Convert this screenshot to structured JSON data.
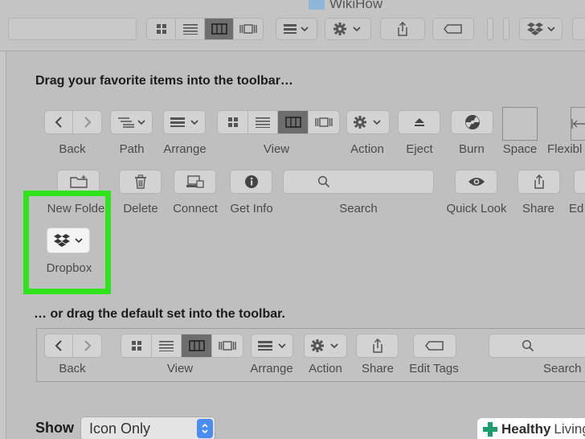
{
  "window": {
    "title": "WikiHow"
  },
  "sheet": {
    "heading_top": "Drag your favorite items into the toolbar…",
    "heading_default": "… or drag the default set into the toolbar.",
    "items_row1": {
      "back": "Back",
      "path": "Path",
      "arrange": "Arrange",
      "view": "View",
      "action": "Action",
      "eject": "Eject",
      "burn": "Burn",
      "space": "Space",
      "flexible": "Flexibl"
    },
    "items_row2": {
      "new_folder": "New Folder",
      "delete": "Delete",
      "connect": "Connect",
      "get_info": "Get Info",
      "search": "Search",
      "quick_look": "Quick Look",
      "share": "Share",
      "edit": "Ed"
    },
    "dropbox": {
      "label": "Dropbox",
      "highlight_color": "#2fe41c"
    },
    "default_set": {
      "back": "Back",
      "view": "View",
      "arrange": "Arrange",
      "action": "Action",
      "share": "Share",
      "edit_tags": "Edit Tags",
      "search": "Search"
    },
    "show": {
      "label": "Show",
      "value": "Icon Only"
    }
  },
  "watermark": {
    "brand": "Healthy",
    "suffix": "Living"
  }
}
